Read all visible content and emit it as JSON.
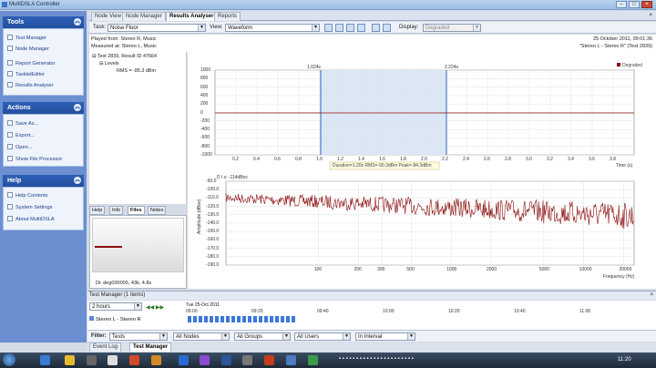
{
  "window": {
    "title": "MultiDSLA Controller"
  },
  "sidebar": {
    "tools": {
      "title": "Tools",
      "items": [
        {
          "label": "Test Manager"
        },
        {
          "label": "Node Manager"
        },
        {
          "label": "Report Generator"
        },
        {
          "label": "TaskletEditor"
        },
        {
          "label": "Results Analyser"
        }
      ]
    },
    "actions": {
      "title": "Actions",
      "items": [
        {
          "label": "Save As..."
        },
        {
          "label": "Export..."
        },
        {
          "label": "Open..."
        },
        {
          "label": "Show File Processor"
        }
      ]
    },
    "help": {
      "title": "Help",
      "items": [
        {
          "label": "Help Contents"
        },
        {
          "label": "System Settings"
        },
        {
          "label": "About MultiDSLA"
        }
      ]
    }
  },
  "tabs": [
    {
      "label": "Node View"
    },
    {
      "label": "Node Manager"
    },
    {
      "label": "Results Analyser",
      "active": true
    },
    {
      "label": "Reports"
    }
  ],
  "toolbar": {
    "task_label": "Task:",
    "task_value": "Noise Floor",
    "view_label": "View:",
    "view_value": "Waveform",
    "display_label": "Display:",
    "display_value": "Degraded"
  },
  "info": {
    "played_from": "Played from: Stereo R, Music",
    "measured_at": "Measured at: Stereo L, Music",
    "date": "25 October 2011, 09:01:36",
    "test_ref": "\"Stereo L - Stereo R\" (Test 2839)"
  },
  "tree": {
    "root": "Test 2839, Result ID 47664",
    "child": "Levels",
    "leaf": "RMS = -85.3 dBm"
  },
  "lower_tabs": [
    {
      "label": "Help"
    },
    {
      "label": "Info"
    },
    {
      "label": "Files",
      "active": true
    },
    {
      "label": "Notes"
    }
  ],
  "preview": {
    "caption": "Di: deg000005, 43k, 4.8s"
  },
  "waveform": {
    "legend": "Degraded",
    "marker_left": "1.024s",
    "marker_right": "2.224s",
    "selection_info": "Duration=1.20s  RMS=-90.3dBm  Peak=-84.3dBm",
    "xlabel": "Time (s)",
    "xticks": [
      "0.2",
      "0.4",
      "0.6",
      "0.8",
      "1.0",
      "1.2",
      "1.4",
      "1.6",
      "1.8",
      "2.0",
      "2.2",
      "2.4",
      "2.6",
      "2.8",
      "3.0",
      "3.2",
      "3.4",
      "3.6",
      "3.8"
    ],
    "yticks": [
      "1000",
      "800",
      "600",
      "400",
      "200",
      "0",
      "-200",
      "-400",
      "-600",
      "-800",
      "-1000"
    ]
  },
  "spectrum": {
    "header": "D l s: -114dBov",
    "ylabel": "Amplitude (dBov)",
    "xlabel": "Frequency (Hz)",
    "yticks": [
      "-90.0",
      "-100.0",
      "-110.0",
      "-120.0",
      "-130.0",
      "-140.0",
      "-150.0",
      "-160.0",
      "-170.0",
      "-180.0",
      "-190.0"
    ],
    "xticks": [
      "100",
      "200",
      "300",
      "500",
      "1000",
      "2000",
      "5000",
      "10000",
      "20000"
    ]
  },
  "test_manager": {
    "title": "Test Manager  (1 items)",
    "range": "2 hours",
    "date": "Tue 25-Oct 2011",
    "times": [
      "09:00",
      "09:20",
      "09:40",
      "10:00",
      "10:20",
      "10:40",
      "11:00"
    ],
    "row_label": "Stereo L - Stereo R"
  },
  "filter": {
    "label": "Filter:",
    "tests": "Tests",
    "nodes": "All Nodes",
    "groups": "All Groups",
    "users": "All Users",
    "interval": "In Interval"
  },
  "bottom_tabs": [
    {
      "label": "Event Log"
    },
    {
      "label": "Test Manager"
    }
  ],
  "taskbar": {
    "clock": "11:20"
  },
  "colors": {
    "accent": "#2d5fb6",
    "trace": "#8b0d0d",
    "selection": "#dce7f6"
  }
}
